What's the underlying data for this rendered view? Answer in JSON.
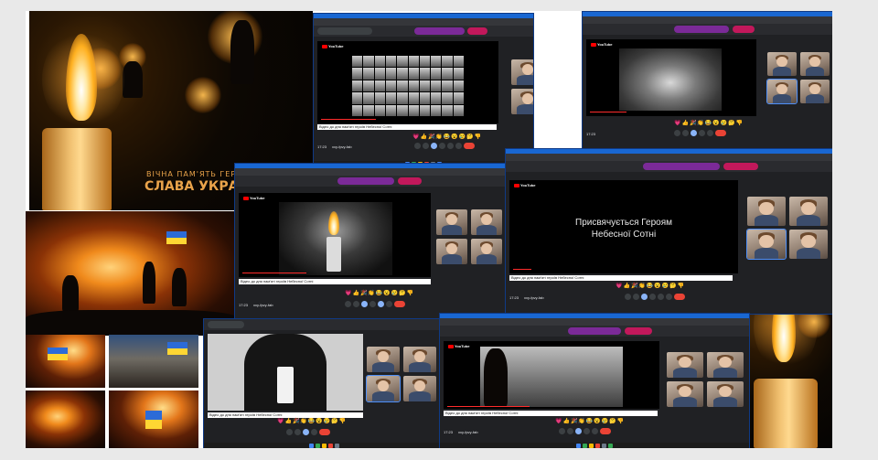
{
  "memorial_banner": {
    "line1": "ВІЧНА ПАМ'ЯТЬ ГЕРОЯМ",
    "line2": "СЛАВА УКРАЇНІ"
  },
  "meet": {
    "video_caption": "Відео до дня пам'яті героїв Небесної Сотні",
    "slide_text_line1": "Присвячується Героям",
    "slide_text_line2": "Небесної Сотні",
    "meeting_time": "17:23",
    "meeting_code": "xxy-fpvy-fab",
    "youtube_label": "YouTube",
    "reactions": "💗👍🎉👏😂😮😢🤔👎",
    "colors": {
      "browser_frame": "#1967d2",
      "meet_bg": "#202124",
      "end_call": "#ea4335",
      "active_control": "#8ab4f8"
    }
  }
}
